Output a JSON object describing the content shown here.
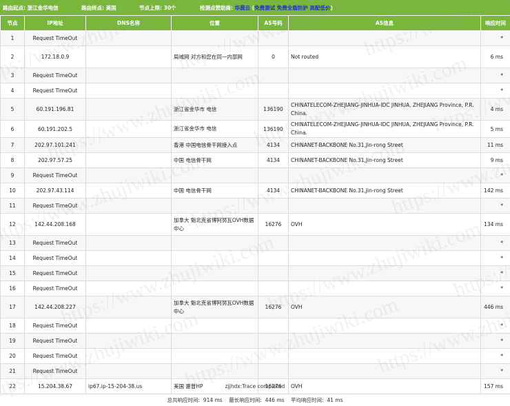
{
  "header": {
    "from_label": "路由起点:",
    "from_value": "浙江金华电信",
    "to_label": "路由终点:",
    "to_value": "美国",
    "hops_label": "节点上限:",
    "hops_value": "30个",
    "sponsor_label": "检测点赞助商:",
    "sponsor_name": "华晨云",
    "sponsor_paren_open": "(",
    "sponsor_links": [
      "免费测试",
      "免费全盾防护",
      "高配低价"
    ],
    "sponsor_paren_close": ")",
    "text_color": "#ffffff",
    "link_color": "#1a2fd0",
    "bg_color": "#79b63c"
  },
  "table": {
    "columns": [
      "节点",
      "IP地址",
      "DNS名称",
      "位置",
      "AS号码",
      "AS信息",
      "响应时间"
    ],
    "rows": [
      {
        "node": "1",
        "ip": "Request TimeOut",
        "dns": "",
        "loc": "",
        "as": "",
        "asinfo": "",
        "time": "*"
      },
      {
        "node": "2",
        "ip": "172.18.0.9",
        "dns": "",
        "loc": "局域网 对方和您在同一内部网",
        "as": "0",
        "asinfo": "Not routed",
        "time": "6 ms"
      },
      {
        "node": "3",
        "ip": "Request TimeOut",
        "dns": "",
        "loc": "",
        "as": "",
        "asinfo": "",
        "time": "*"
      },
      {
        "node": "4",
        "ip": "Request TimeOut",
        "dns": "",
        "loc": "",
        "as": "",
        "asinfo": "",
        "time": "*"
      },
      {
        "node": "5",
        "ip": "60.191.196.81",
        "dns": "",
        "loc": "浙江省金华市 电信",
        "as": "136190",
        "asinfo": "CHINATELECOM-ZHEJIANG-JINHUA-IDC JINHUA, ZHEJIANG Province, P.R. China.",
        "time": "4 ms"
      },
      {
        "node": "6",
        "ip": "60.191.202.5",
        "dns": "",
        "loc": "浙江省金华市 电信",
        "as": "136190",
        "asinfo": "CHINATELECOM-ZHEJIANG-JINHUA-IDC JINHUA, ZHEJIANG Province, P.R. China.",
        "time": "5 ms"
      },
      {
        "node": "7",
        "ip": "202.97.101.241",
        "dns": "",
        "loc": "香港 中国电信骨干网接入点",
        "as": "4134",
        "asinfo": "CHINANET-BACKBONE No.31,Jin-rong Street",
        "time": "11 ms"
      },
      {
        "node": "8",
        "ip": "202.97.57.25",
        "dns": "",
        "loc": "中国 电信骨干网",
        "as": "4134",
        "asinfo": "CHINANET-BACKBONE No.31,Jin-rong Street",
        "time": "9 ms"
      },
      {
        "node": "9",
        "ip": "Request TimeOut",
        "dns": "",
        "loc": "",
        "as": "",
        "asinfo": "",
        "time": "*"
      },
      {
        "node": "10",
        "ip": "202.97.43.114",
        "dns": "",
        "loc": "中国 电信骨干网",
        "as": "4134",
        "asinfo": "CHINANET-BACKBONE No.31,Jin-rong Street",
        "time": "142 ms"
      },
      {
        "node": "11",
        "ip": "Request TimeOut",
        "dns": "",
        "loc": "",
        "as": "",
        "asinfo": "",
        "time": "*"
      },
      {
        "node": "12",
        "ip": "142.44.208.168",
        "dns": "",
        "loc": "加拿大 魁北克省博阿努瓦OVH数据中心",
        "as": "16276",
        "asinfo": "OVH",
        "time": "134 ms"
      },
      {
        "node": "13",
        "ip": "Request TimeOut",
        "dns": "",
        "loc": "",
        "as": "",
        "asinfo": "",
        "time": "*"
      },
      {
        "node": "14",
        "ip": "Request TimeOut",
        "dns": "",
        "loc": "",
        "as": "",
        "asinfo": "",
        "time": "*"
      },
      {
        "node": "15",
        "ip": "Request TimeOut",
        "dns": "",
        "loc": "",
        "as": "",
        "asinfo": "",
        "time": "*"
      },
      {
        "node": "16",
        "ip": "Request TimeOut",
        "dns": "",
        "loc": "",
        "as": "",
        "asinfo": "",
        "time": "*"
      },
      {
        "node": "17",
        "ip": "142.44.208.227",
        "dns": "",
        "loc": "加拿大 魁北克省博阿努瓦OVH数据中心",
        "as": "16276",
        "asinfo": "OVH",
        "time": "446 ms"
      },
      {
        "node": "18",
        "ip": "Request TimeOut",
        "dns": "",
        "loc": "",
        "as": "",
        "asinfo": "",
        "time": "*"
      },
      {
        "node": "19",
        "ip": "Request TimeOut",
        "dns": "",
        "loc": "",
        "as": "",
        "asinfo": "",
        "time": "*"
      },
      {
        "node": "20",
        "ip": "Request TimeOut",
        "dns": "",
        "loc": "",
        "as": "",
        "asinfo": "",
        "time": "*"
      },
      {
        "node": "21",
        "ip": "Request TimeOut",
        "dns": "",
        "loc": "",
        "as": "",
        "asinfo": "",
        "time": "*"
      },
      {
        "node": "22",
        "ip": "15.204.38.67",
        "dns": "ip67.ip-15-204-38.us",
        "loc": "美国 惠普HP",
        "as": "16276",
        "asinfo": "OVH",
        "time": "157 ms"
      }
    ]
  },
  "footer": {
    "trace_status": "zjjhdx:Trace completed",
    "total_label": "总共响应时间:",
    "total_value": "914 ms",
    "max_label": "最长响应时间:",
    "max_value": "446 ms",
    "avg_label": "平均响应时间:",
    "avg_value": "41 ms"
  },
  "watermark": {
    "text": "https://www.zhujiwiki.com"
  }
}
